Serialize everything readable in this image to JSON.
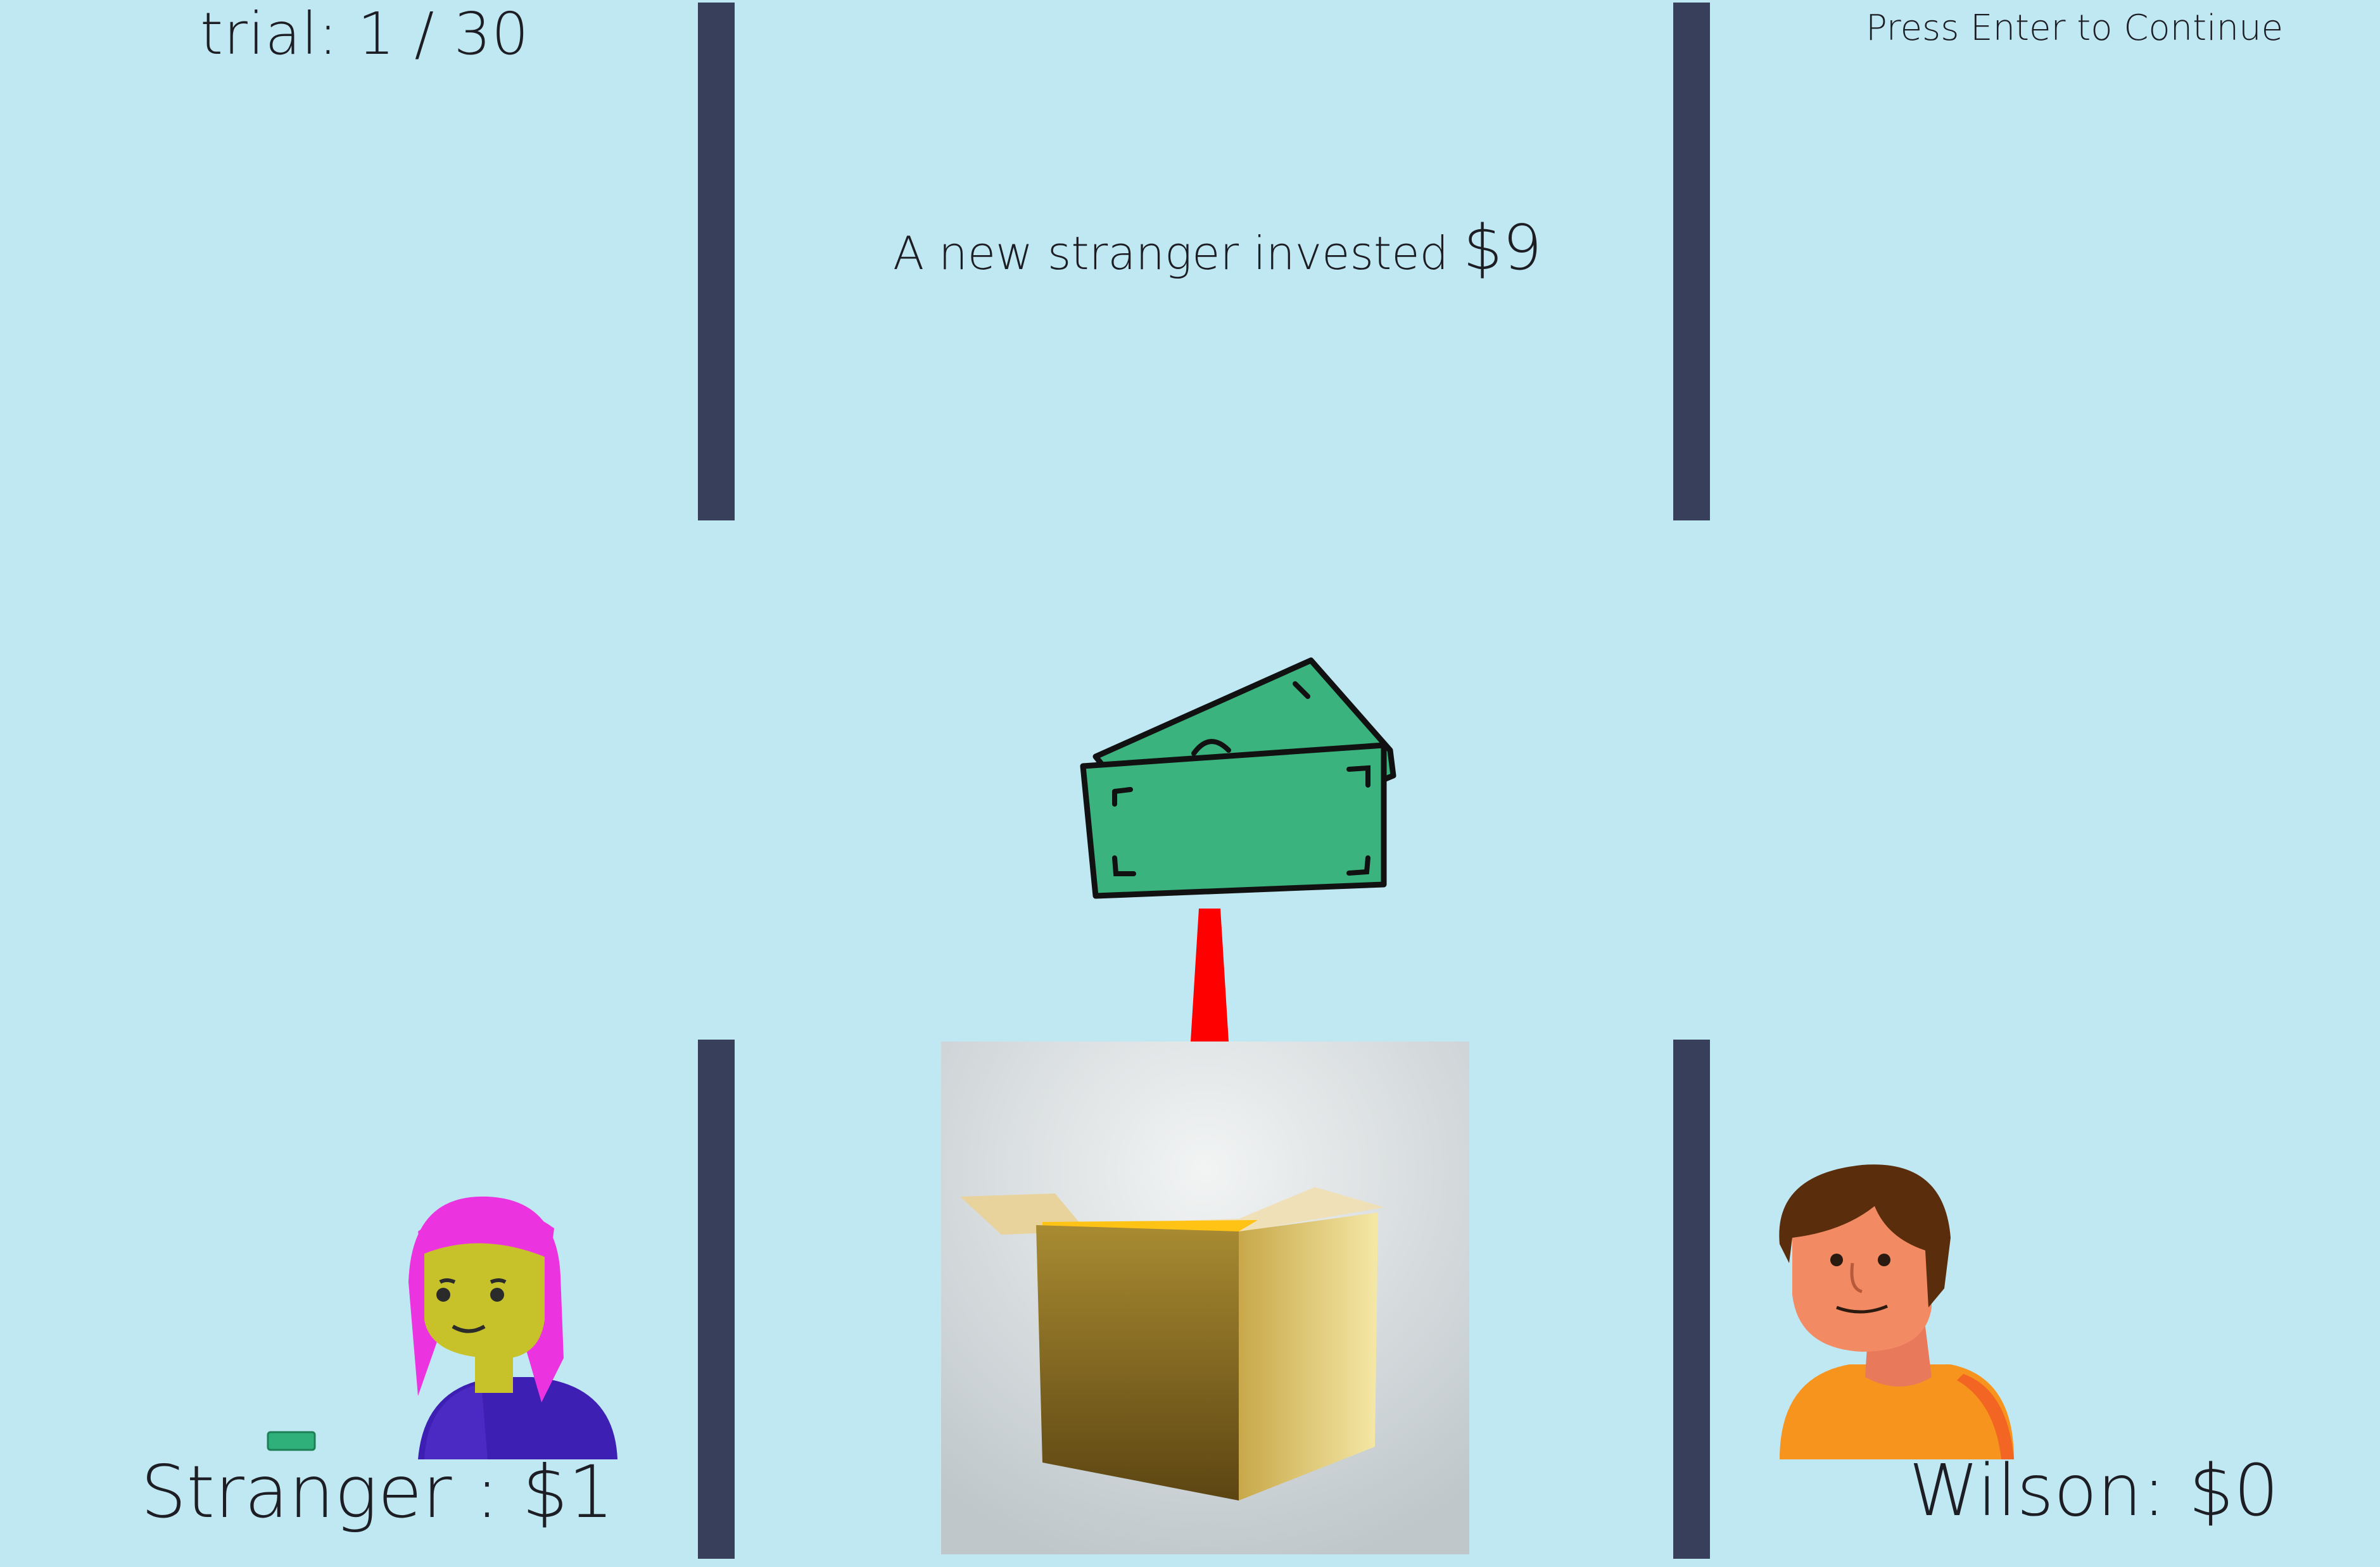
{
  "header": {
    "trial_label": "trial: 1 / 30",
    "instruction": "Press Enter to Continue"
  },
  "message": {
    "text": "A new stranger invested",
    "amount": "$9"
  },
  "players": {
    "left": {
      "label": "Stranger : $1"
    },
    "right": {
      "label": "Wilson: $0"
    }
  },
  "colors": {
    "background": "#c0e8f3",
    "divider": "#383f5a",
    "money": "#3ab37e",
    "arrow": "#ff0000",
    "box": "#b89a3c"
  },
  "icons": {
    "money": "money-bills-icon",
    "arrow": "down-arrow-icon",
    "box": "open-box-icon",
    "stranger": "stranger-avatar",
    "wilson": "wilson-avatar",
    "small_bill": "small-bill-icon"
  }
}
